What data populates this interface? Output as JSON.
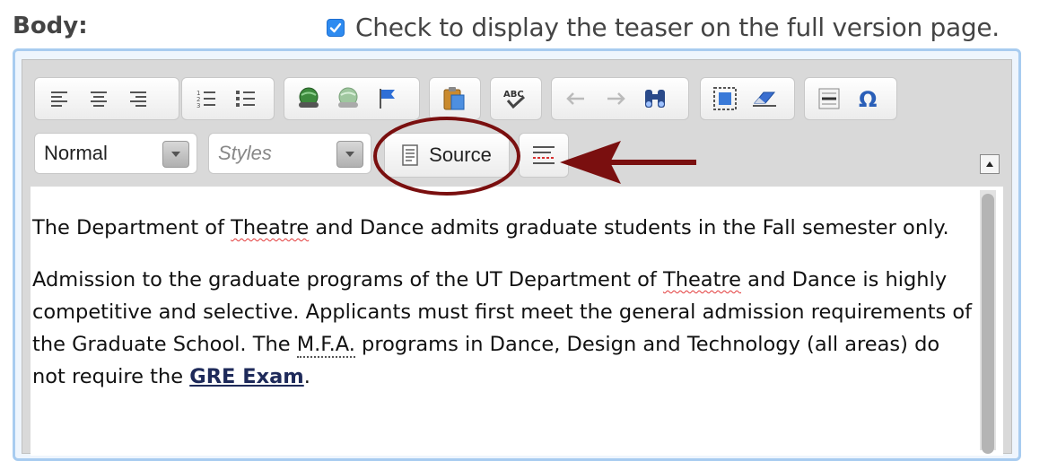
{
  "form": {
    "body_label": "Body:",
    "teaser_checkbox_checked": true,
    "teaser_label": "Check to display the teaser on the full version page."
  },
  "toolbar": {
    "groups": [
      [
        "align-left-icon",
        "align-center-icon",
        "align-right-icon"
      ],
      [
        "numbered-list-icon",
        "bulleted-list-icon"
      ],
      [
        "link-icon",
        "unlink-icon",
        "anchor-flag-icon"
      ],
      [
        "paste-icon"
      ],
      [
        "spellcheck-icon"
      ],
      [
        "undo-icon",
        "redo-icon",
        "find-icon"
      ],
      [
        "select-all-icon",
        "remove-format-icon"
      ],
      [
        "horizontal-rule-icon",
        "special-character-icon"
      ]
    ],
    "format_combo_value": "Normal",
    "styles_combo_placeholder": "Styles",
    "source_label": "Source"
  },
  "content": {
    "p1": {
      "before": "The Department of ",
      "misspelled": "Theatre",
      "after": " and Dance admits graduate students in the Fall semester only."
    },
    "p2": {
      "part1": "Admission to the graduate programs of the UT Department of ",
      "misspelled": "Theatre",
      "part2": " and Dance is highly competitive and selective. Applicants must first meet the general admission requirements of the Graduate School. The ",
      "abbr": "M.F.A.",
      "part3": " programs in Dance, Design and Technology (all areas) do not require the ",
      "link": "GRE Exam",
      "part4": "."
    }
  },
  "colors": {
    "annotation": "#7a0f0f",
    "checkbox": "#2e8bf0",
    "frame": "#a8ccf0",
    "link": "#1e2a5a"
  }
}
